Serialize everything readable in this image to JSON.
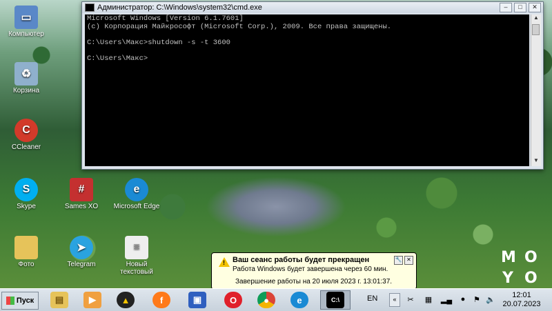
{
  "desktop_icons": [
    {
      "label": "Компьютер",
      "icon": "computer-icon",
      "color": "#5a88c8"
    },
    {
      "label": "Корзина",
      "icon": "recycle-bin-icon",
      "color": "#8fb0cc"
    },
    {
      "label": "CCleaner",
      "icon": "ccleaner-icon",
      "color": "#d23a2a"
    },
    {
      "label": "Skype",
      "icon": "skype-icon",
      "color": "#00aff0"
    },
    {
      "label": "Sames XO",
      "icon": "tic-tac-toe-icon",
      "color": "#c43030"
    },
    {
      "label": "Microsoft Edge",
      "icon": "edge-icon",
      "color": "#1a8ad4"
    },
    {
      "label": "Фото",
      "icon": "folder-icon",
      "color": "#e6c35a"
    },
    {
      "label": "Telegram",
      "icon": "telegram-icon",
      "color": "#2aa3e0"
    },
    {
      "label": "Новый текстовый",
      "icon": "text-file-icon",
      "color": "#eeeeee"
    }
  ],
  "cmd": {
    "title": "Администратор: C:\\Windows\\system32\\cmd.exe",
    "lines": [
      "Microsoft Windows [Version 6.1.7601]",
      "(c) Корпорация Майкрософт (Microsoft Corp.), 2009. Все права защищены.",
      "",
      "C:\\Users\\Макс>shutdown -s -t 3600",
      "",
      "C:\\Users\\Макс>"
    ],
    "minimize": "–",
    "maximize": "□",
    "close": "✕"
  },
  "balloon": {
    "title": "Ваш сеанс работы будет прекращен",
    "line1": "Работа Windows будет завершена через 60 мин.",
    "line2": "Завершение работы на 20 июля 2023 г. 13:01:37."
  },
  "taskbar": {
    "start_label": "Пуск",
    "language": "EN",
    "time": "12:01",
    "date": "20.07.2023"
  },
  "watermark": "MOYO"
}
